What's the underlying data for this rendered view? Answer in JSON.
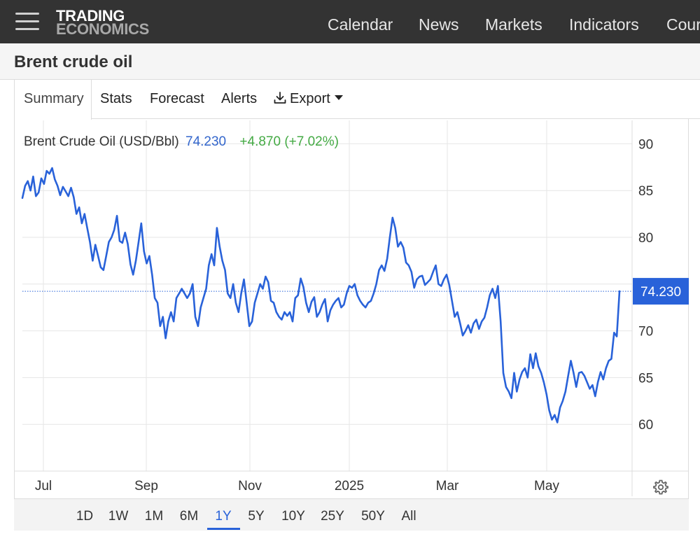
{
  "nav": {
    "logo_line1": "TRADING",
    "logo_line2": "ECONOMICS",
    "items": [
      "Calendar",
      "News",
      "Markets",
      "Indicators",
      "Cour"
    ]
  },
  "page": {
    "title": "Brent crude oil"
  },
  "tabs": [
    {
      "label": "Summary",
      "active": true
    },
    {
      "label": "Stats"
    },
    {
      "label": "Forecast"
    },
    {
      "label": "Alerts"
    },
    {
      "label": "Export",
      "icon": "download-icon",
      "dropdown": true
    }
  ],
  "legend": {
    "name": "Brent Crude Oil (USD/Bbl)",
    "last": "74.230",
    "change": "+4.870 (+7.02%)"
  },
  "ranges": {
    "items": [
      "1D",
      "1W",
      "1M",
      "6M",
      "1Y",
      "5Y",
      "10Y",
      "25Y",
      "50Y",
      "All"
    ],
    "selected": "1Y"
  },
  "colors": {
    "line": "#2962d9",
    "last_value_tag": "#2962d9",
    "positive_change": "#44aa44",
    "topbar": "#333333"
  },
  "chart_data": {
    "type": "line",
    "title": "Brent Crude Oil (USD/Bbl)",
    "x_ticks": [
      "Jul",
      "Sep",
      "Nov",
      "2025",
      "Mar",
      "May"
    ],
    "y_ticks": [
      60,
      65,
      70,
      75,
      80,
      85,
      90
    ],
    "ylim": [
      55,
      92.5
    ],
    "y_axis_side": "right",
    "grid": true,
    "last_value": 74.23,
    "last_value_label": "74.230",
    "series": [
      {
        "values": [
          84.2,
          85.5,
          86.0,
          85.0,
          86.5,
          84.4,
          84.8,
          86.3,
          85.7,
          87.1,
          86.8,
          87.4,
          86.2,
          85.5,
          84.5,
          85.4,
          84.9,
          84.4,
          85.3,
          84.3,
          82.5,
          83.2,
          81.5,
          82.5,
          81.0,
          79.5,
          77.5,
          79.2,
          78.0,
          76.8,
          76.5,
          78.0,
          79.5,
          80.0,
          80.8,
          82.3,
          79.6,
          79.4,
          80.5,
          79.3,
          77.1,
          76.0,
          77.5,
          79.5,
          81.5,
          78.5,
          77.2,
          78.0,
          76.0,
          73.5,
          73.0,
          70.5,
          71.5,
          69.2,
          71.0,
          72.0,
          71.0,
          73.5,
          74.0,
          74.5,
          74.0,
          73.5,
          74.0,
          75.0,
          71.5,
          70.5,
          72.5,
          73.5,
          74.5,
          77.0,
          78.2,
          77.0,
          81.0,
          79.0,
          77.5,
          76.5,
          74.0,
          73.5,
          75.0,
          73.0,
          72.0,
          74.0,
          75.5,
          73.0,
          70.5,
          71.0,
          73.0,
          74.0,
          75.0,
          74.5,
          75.8,
          75.2,
          73.2,
          73.0,
          72.0,
          71.5,
          71.2,
          72.0,
          71.6,
          72.0,
          71.0,
          73.5,
          73.8,
          75.6,
          74.7,
          73.0,
          72.0,
          73.1,
          73.6,
          71.5,
          72.0,
          72.8,
          73.4,
          71.0,
          72.2,
          72.8,
          73.2,
          73.5,
          72.5,
          72.8,
          74.0,
          74.8,
          74.6,
          75.0,
          73.8,
          73.2,
          72.8,
          72.5,
          73.0,
          73.2,
          74.0,
          75.0,
          76.5,
          77.0,
          76.4,
          77.7,
          80.0,
          82.1,
          81.0,
          79.0,
          79.5,
          78.9,
          77.3,
          77.0,
          76.3,
          74.6,
          75.5,
          75.8,
          75.9,
          74.9,
          75.2,
          75.5,
          76.3,
          77.0,
          75.0,
          74.8,
          75.5,
          76.0,
          74.9,
          73.2,
          71.5,
          72.0,
          70.8,
          69.5,
          70.0,
          70.6,
          69.8,
          70.8,
          71.2,
          70.2,
          71.0,
          71.4,
          72.5,
          73.8,
          74.5,
          73.5,
          74.8,
          71.0,
          65.5,
          64.0,
          63.5,
          62.8,
          65.5,
          63.5,
          64.8,
          65.6,
          66.0,
          65.0,
          67.5,
          66.0,
          67.6,
          66.2,
          65.5,
          64.5,
          63.2,
          61.5,
          60.5,
          61.0,
          60.2,
          61.8,
          62.5,
          63.5,
          65.2,
          66.8,
          65.5,
          64.0,
          65.5,
          65.6,
          65.2,
          64.5,
          63.8,
          64.2,
          63.0,
          64.5,
          65.6,
          64.8,
          66.0,
          66.8,
          67.0,
          69.8,
          69.4,
          74.23
        ]
      }
    ]
  }
}
